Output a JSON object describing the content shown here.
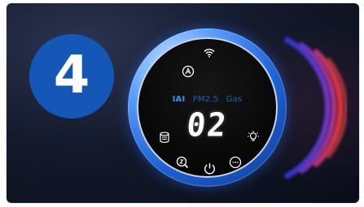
{
  "step": {
    "number": "4"
  },
  "display": {
    "modes": [
      "IAI",
      "PM2.5",
      "Gas"
    ],
    "active_mode": "IAI",
    "readout": "02"
  },
  "icons": [
    "wifi-icon",
    "auto-mode-icon",
    "filter-icon",
    "light-icon",
    "sleep-icon",
    "power-icon",
    "timer-icon"
  ],
  "colors": {
    "accent_blue": "#1557b6",
    "active_mode": "#2f96ff",
    "inactive_mode": "#1a63b0",
    "ring_blue": "#1d61d6",
    "wave_blue": "#3a3fd6",
    "wave_red": "#ff3a4a"
  }
}
